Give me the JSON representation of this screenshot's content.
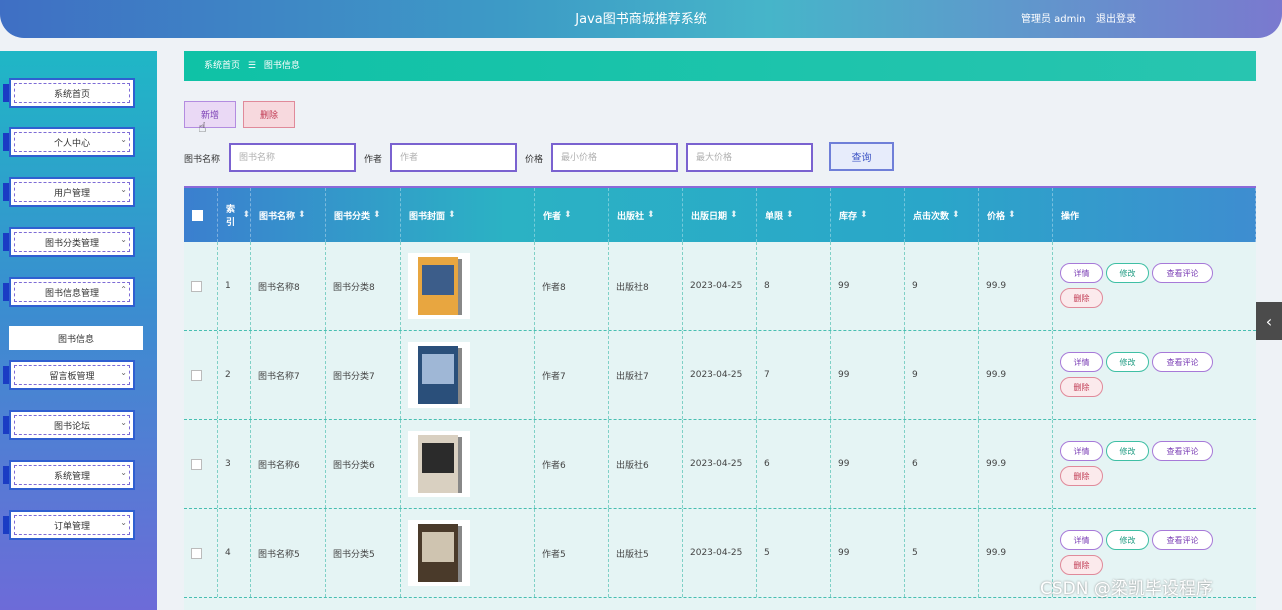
{
  "header": {
    "title": "Java图书商城推荐系统",
    "user": "管理员 admin",
    "logout": "退出登录"
  },
  "sidebar": {
    "items": [
      {
        "label": "系统首页"
      },
      {
        "label": "个人中心"
      },
      {
        "label": "用户管理"
      },
      {
        "label": "图书分类管理"
      },
      {
        "label": "图书信息管理"
      },
      {
        "label": "留言板管理"
      },
      {
        "label": "图书论坛"
      },
      {
        "label": "系统管理"
      },
      {
        "label": "订单管理"
      }
    ],
    "submenu": "图书信息"
  },
  "breadcrumb": {
    "home": "系统首页",
    "sep": "☰",
    "current": "图书信息"
  },
  "toolbar": {
    "add": "新增",
    "delete": "删除"
  },
  "search": {
    "name_label": "图书名称",
    "name_placeholder": "图书名称",
    "author_label": "作者",
    "author_placeholder": "作者",
    "price_label": "价格",
    "min_placeholder": "最小价格",
    "max_placeholder": "最大价格",
    "query": "查询"
  },
  "table": {
    "headers": [
      "索引",
      "图书名称",
      "图书分类",
      "图书封面",
      "作者",
      "出版社",
      "出版日期",
      "单限",
      "库存",
      "点击次数",
      "价格",
      "操作"
    ],
    "sort_glyph": "⬍",
    "rows": [
      {
        "idx": "1",
        "name": "图书名称8",
        "cat": "图书分类8",
        "author": "作者8",
        "pub": "出版社8",
        "date": "2023-04-25",
        "limit": "8",
        "stock": "99",
        "clicks": "9",
        "price": "99.9"
      },
      {
        "idx": "2",
        "name": "图书名称7",
        "cat": "图书分类7",
        "author": "作者7",
        "pub": "出版社7",
        "date": "2023-04-25",
        "limit": "7",
        "stock": "99",
        "clicks": "9",
        "price": "99.9"
      },
      {
        "idx": "3",
        "name": "图书名称6",
        "cat": "图书分类6",
        "author": "作者6",
        "pub": "出版社6",
        "date": "2023-04-25",
        "limit": "6",
        "stock": "99",
        "clicks": "6",
        "price": "99.9"
      },
      {
        "idx": "4",
        "name": "图书名称5",
        "cat": "图书分类5",
        "author": "作者5",
        "pub": "出版社5",
        "date": "2023-04-25",
        "limit": "5",
        "stock": "99",
        "clicks": "5",
        "price": "99.9"
      }
    ],
    "ops": {
      "detail": "详情",
      "edit": "修改",
      "review": "查看评论",
      "delete": "删除"
    }
  },
  "watermark": "CSDN @梁凯毕设程序",
  "colors": {
    "accent": "#1fc2a8",
    "purple": "#7b3fb5",
    "danger": "#c03952"
  }
}
